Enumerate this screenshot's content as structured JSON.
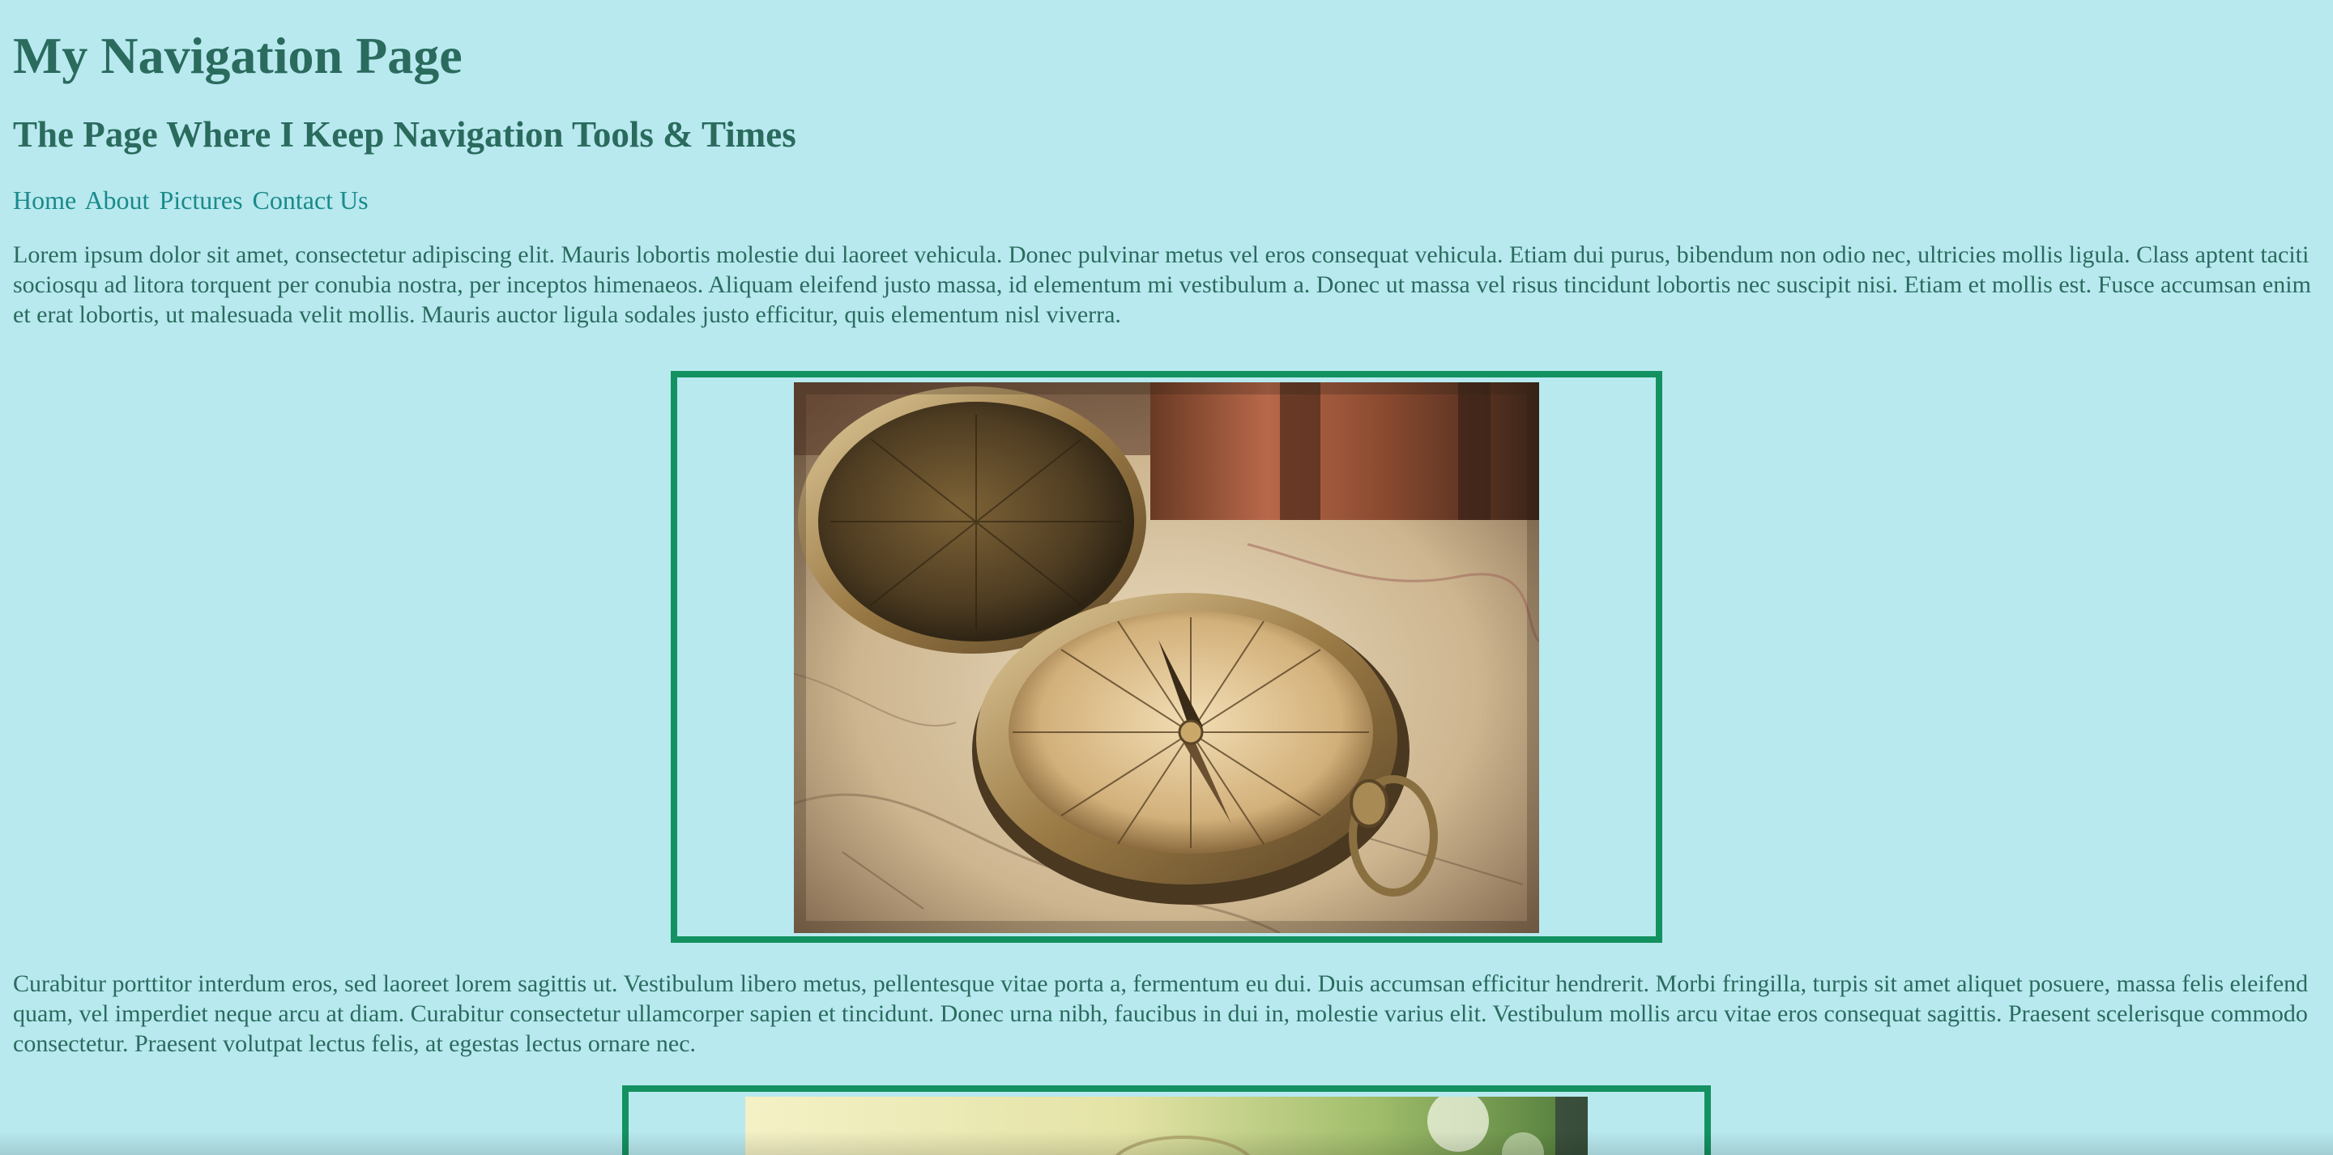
{
  "header": {
    "title": "My Navigation Page",
    "subtitle": "The Page Where I Keep Navigation Tools & Times"
  },
  "nav": {
    "items": [
      "Home",
      "About",
      "Pictures",
      "Contact Us"
    ]
  },
  "content": {
    "paragraph1": "Lorem ipsum dolor sit amet, consectetur adipiscing elit. Mauris lobortis molestie dui laoreet vehicula. Donec pulvinar metus vel eros consequat vehicula. Etiam dui purus, bibendum non odio nec, ultricies mollis ligula. Class aptent taciti sociosqu ad litora torquent per conubia nostra, per inceptos himenaeos. Aliquam eleifend justo massa, id elementum mi vestibulum a. Donec ut massa vel risus tincidunt lobortis nec suscipit nisi. Etiam et mollis est. Fusce accumsan enim et erat lobortis, ut malesuada velit mollis. Mauris auctor ligula sodales justo efficitur, quis elementum nisl viverra.",
    "paragraph2": "Curabitur porttitor interdum eros, sed laoreet lorem sagittis ut. Vestibulum libero metus, pellentesque vitae porta a, fermentum eu dui. Duis accumsan efficitur hendrerit. Morbi fringilla, turpis sit amet aliquet posuere, massa felis eleifend quam, vel imperdiet neque arcu at diam. Curabitur consectetur ullamcorper sapien et tincidunt. Donec urna nibh, faucibus in dui in, molestie varius elit. Vestibulum mollis arcu vitae eros consequat sagittis. Praesent scelerisque commodo consectetur. Praesent volutpat lectus felis, at egestas lectus ornare nec."
  },
  "images": {
    "image1": "compass-on-map-image",
    "image2": "green-bokeh-image"
  },
  "colors": {
    "background": "#b8e9ef",
    "text": "#2a6b5e",
    "link": "#1a8a8a",
    "frame_border": "#149160"
  }
}
